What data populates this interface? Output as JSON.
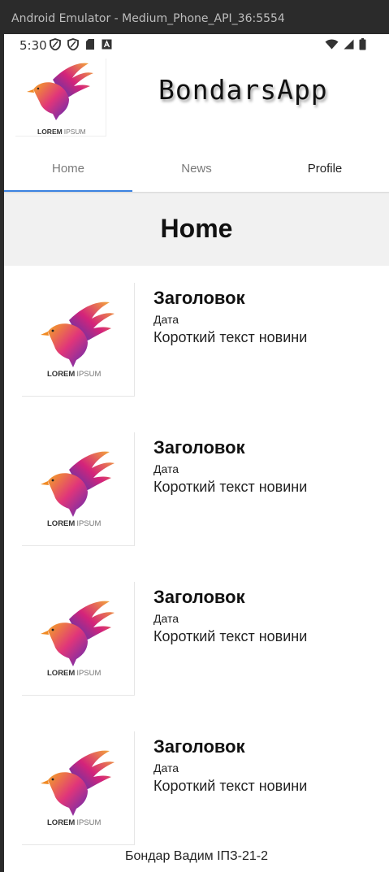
{
  "window": {
    "title": "Android Emulator - Medium_Phone_API_36:5554"
  },
  "status_bar": {
    "time": "5:30",
    "left_icons": [
      "shield-icon",
      "shield-icon",
      "sd-card-icon",
      "keyboard-a-icon"
    ],
    "right_icons": [
      "wifi-icon",
      "signal-icon",
      "battery-icon"
    ]
  },
  "header": {
    "logo_text_bold": "LOREM",
    "logo_text_light": "IPSUM",
    "app_title": "BondarsApp"
  },
  "tabs": [
    {
      "label": "Home",
      "active": true
    },
    {
      "label": "News",
      "active": false
    },
    {
      "label": "Profile",
      "active": false
    }
  ],
  "page": {
    "heading": "Home"
  },
  "news": [
    {
      "title": "Заголовок",
      "date": "Дата",
      "text": "Короткий текст новини",
      "logo_bold": "LOREM",
      "logo_light": "IPSUM"
    },
    {
      "title": "Заголовок",
      "date": "Дата",
      "text": "Короткий текст новини",
      "logo_bold": "LOREM",
      "logo_light": "IPSUM"
    },
    {
      "title": "Заголовок",
      "date": "Дата",
      "text": "Короткий текст новини",
      "logo_bold": "LOREM",
      "logo_light": "IPSUM"
    },
    {
      "title": "Заголовок",
      "date": "Дата",
      "text": "Короткий текст новини",
      "logo_bold": "LOREM",
      "logo_light": "IPSUM"
    }
  ],
  "footer": {
    "text": "Бондар Вадим ІПЗ-21-2"
  },
  "colors": {
    "tab_indicator": "#3b82e0",
    "heading_bg": "#f1f1f1"
  }
}
